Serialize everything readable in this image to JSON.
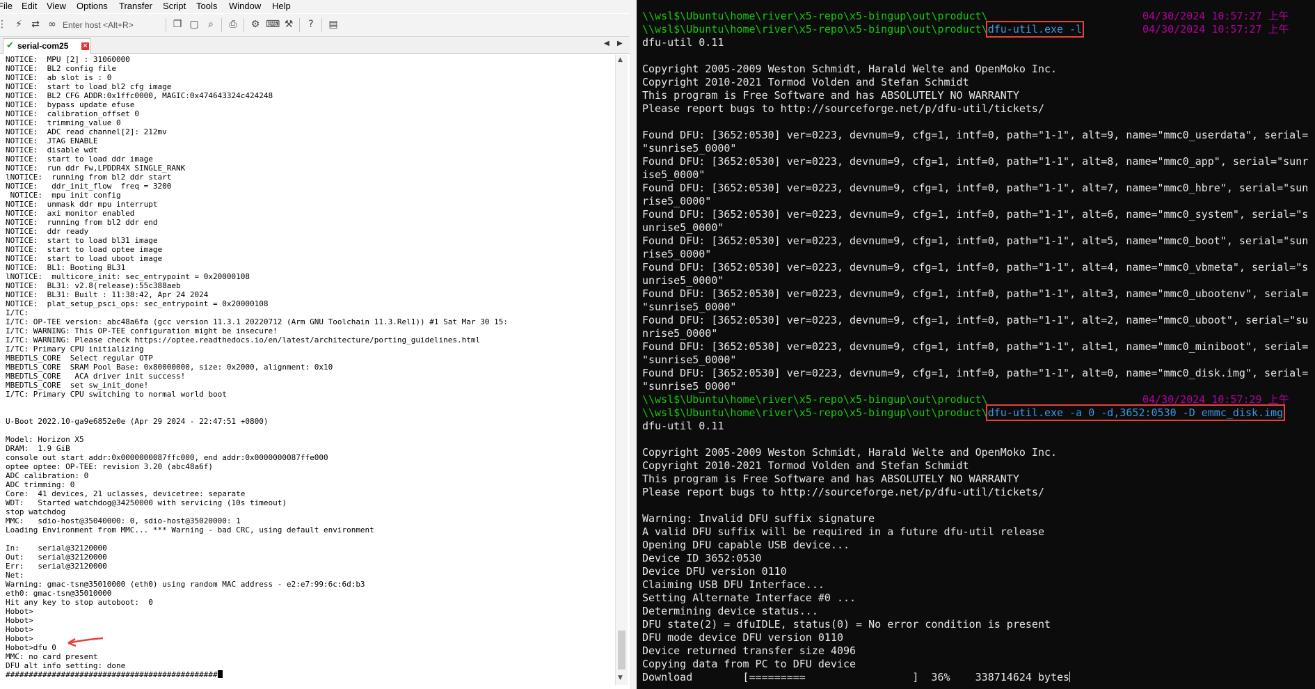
{
  "menu": [
    "File",
    "Edit",
    "View",
    "Options",
    "Transfer",
    "Script",
    "Tools",
    "Window",
    "Help"
  ],
  "toolbar": {
    "host_placeholder": "Enter host <Alt+R>",
    "icons": [
      "lightning-icon",
      "reconnect-icon",
      "link-icon",
      "copy-icon",
      "paste-icon",
      "find-icon",
      "print-icon",
      "settings-icon",
      "keymap-icon",
      "sftp-icon",
      "help-icon",
      "log-icon"
    ]
  },
  "tab": {
    "label": "serial-com25"
  },
  "serial_lines": [
    "NOTICE:  MPU [2] : 31060000",
    "NOTICE:  BL2 config file",
    "NOTICE:  ab slot is : 0",
    "NOTICE:  start to load bl2 cfg image",
    "NOTICE:  BL2 CFG ADDR:0x1ffc0000, MAGIC:0x474643324c424248",
    "NOTICE:  bypass update efuse",
    "NOTICE:  calibration_offset 0",
    "NOTICE:  trimming_value 0",
    "NOTICE:  ADC read channel[2]: 212mv",
    "NOTICE:  JTAG ENABLE",
    "NOTICE:  disable wdt",
    "NOTICE:  start to load ddr image",
    "NOTICE:  run ddr Fw,LPDDR4X SINGLE_RANK",
    "lNOTICE:  running from bl2 ddr start",
    "NOTICE:   ddr_init_flow  freq = 3200",
    " NOTICE:  mpu init config",
    "NOTICE:  unmask ddr mpu interrupt",
    "NOTICE:  axi monitor enabled",
    "NOTICE:  running from bl2 ddr end",
    "NOTICE:  ddr ready",
    "NOTICE:  start to load bl31 image",
    "NOTICE:  start to load optee image",
    "NOTICE:  start to load uboot image",
    "NOTICE:  BL1: Booting BL31",
    "lNOTICE:  multicore_init: sec_entrypoint = 0x20000108",
    "NOTICE:  BL31: v2.8(release):55c388aeb",
    "NOTICE:  BL31: Built : 11:38:42, Apr 24 2024",
    "NOTICE:  plat_setup_psci_ops: sec_entrypoint = 0x20000108",
    "I/TC:",
    "I/TC: OP-TEE version: abc48a6fa (gcc version 11.3.1 20220712 (Arm GNU Toolchain 11.3.Rel1)) #1 Sat Mar 30 15:",
    "I/TC: WARNING: This OP-TEE configuration might be insecure!",
    "I/TC: WARNING: Please check https://optee.readthedocs.io/en/latest/architecture/porting_guidelines.html",
    "I/TC: Primary CPU initializing",
    "MBEDTLS_CORE  Select regular OTP",
    "MBEDTLS_CORE  SRAM Pool Base: 0x80000000, size: 0x2000, alignment: 0x10",
    "MBEDTLS_CORE   ACA driver init success!",
    "MBEDTLS_CORE  set sw_init_done!",
    "I/TC: Primary CPU switching to normal world boot",
    "",
    "",
    "U-Boot 2022.10-ga9e6852e0e (Apr 29 2024 - 22:47:51 +0800)",
    "",
    "Model: Horizon X5",
    "DRAM:  1.9 GiB",
    "console out start addr:0x0000000087ffc000, end addr:0x0000000087ffe000",
    "optee optee: OP-TEE: revision 3.20 (abc48a6f)",
    "ADC calibration: 0",
    "ADC trimming: 0",
    "Core:  41 devices, 21 uclasses, devicetree: separate",
    "WDT:   Started watchdog@34250000 with servicing (10s timeout)",
    "stop watchdog",
    "MMC:   sdio-host@35040000: 0, sdio-host@35020000: 1",
    "Loading Environment from MMC... *** Warning - bad CRC, using default environment",
    "",
    "In:    serial@32120000",
    "Out:   serial@32120000",
    "Err:   serial@32120000",
    "Net:",
    "Warning: gmac-tsn@35010000 (eth0) using random MAC address - e2:e7:99:6c:6d:b3",
    "eth0: gmac-tsn@35010000",
    "Hit any key to stop autoboot:  0",
    "Hobot>",
    "Hobot>",
    "Hobot>",
    "Hobot>",
    "Hobot>dfu 0",
    "MMC: no card present",
    "DFU alt info setting: done",
    "##############################################"
  ],
  "terminal": {
    "prompt": "\\\\wsl$\\Ubuntu\\home\\river\\x5-repo\\x5-bingup\\out\\product\\",
    "timestamps": [
      "04/30/2024 10:57:27 上午",
      "04/30/2024 10:57:27 上午",
      "04/30/2024 10:57:29 上午"
    ],
    "cmd1": "dfu-util.exe -l",
    "cmd2": "dfu-util.exe -a 0 -d,3652:0530 -D emmc_disk.img",
    "block1": [
      "dfu-util 0.11",
      "",
      "Copyright 2005-2009 Weston Schmidt, Harald Welte and OpenMoko Inc.",
      "Copyright 2010-2021 Tormod Volden and Stefan Schmidt",
      "This program is Free Software and has ABSOLUTELY NO WARRANTY",
      "Please report bugs to http://sourceforge.net/p/dfu-util/tickets/",
      "",
      "Found DFU: [3652:0530] ver=0223, devnum=9, cfg=1, intf=0, path=\"1-1\", alt=9, name=\"mmc0_userdata\", serial=",
      "\"sunrise5_0000\"",
      "Found DFU: [3652:0530] ver=0223, devnum=9, cfg=1, intf=0, path=\"1-1\", alt=8, name=\"mmc0_app\", serial=\"sunr",
      "ise5_0000\"",
      "Found DFU: [3652:0530] ver=0223, devnum=9, cfg=1, intf=0, path=\"1-1\", alt=7, name=\"mmc0_hbre\", serial=\"sun",
      "rise5_0000\"",
      "Found DFU: [3652:0530] ver=0223, devnum=9, cfg=1, intf=0, path=\"1-1\", alt=6, name=\"mmc0_system\", serial=\"s",
      "unrise5_0000\"",
      "Found DFU: [3652:0530] ver=0223, devnum=9, cfg=1, intf=0, path=\"1-1\", alt=5, name=\"mmc0_boot\", serial=\"sun",
      "rise5_0000\"",
      "Found DFU: [3652:0530] ver=0223, devnum=9, cfg=1, intf=0, path=\"1-1\", alt=4, name=\"mmc0_vbmeta\", serial=\"s",
      "unrise5_0000\"",
      "Found DFU: [3652:0530] ver=0223, devnum=9, cfg=1, intf=0, path=\"1-1\", alt=3, name=\"mmc0_ubootenv\", serial=",
      "\"sunrise5_0000\"",
      "Found DFU: [3652:0530] ver=0223, devnum=9, cfg=1, intf=0, path=\"1-1\", alt=2, name=\"mmc0_uboot\", serial=\"su",
      "nrise5_0000\"",
      "Found DFU: [3652:0530] ver=0223, devnum=9, cfg=1, intf=0, path=\"1-1\", alt=1, name=\"mmc0_miniboot\", serial=",
      "\"sunrise5_0000\"",
      "Found DFU: [3652:0530] ver=0223, devnum=9, cfg=1, intf=0, path=\"1-1\", alt=0, name=\"mmc0_disk.img\", serial=",
      "\"sunrise5_0000\""
    ],
    "block2": [
      "dfu-util 0.11",
      "",
      "Copyright 2005-2009 Weston Schmidt, Harald Welte and OpenMoko Inc.",
      "Copyright 2010-2021 Tormod Volden and Stefan Schmidt",
      "This program is Free Software and has ABSOLUTELY NO WARRANTY",
      "Please report bugs to http://sourceforge.net/p/dfu-util/tickets/",
      "",
      "Warning: Invalid DFU suffix signature",
      "A valid DFU suffix will be required in a future dfu-util release",
      "Opening DFU capable USB device...",
      "Device ID 3652:0530",
      "Device DFU version 0110",
      "Claiming USB DFU Interface...",
      "Setting Alternate Interface #0 ...",
      "Determining device status...",
      "DFU state(2) = dfuIDLE, status(0) = No error condition is present",
      "DFU mode device DFU version 0110",
      "Device returned transfer size 4096",
      "Copying data from PC to DFU device"
    ],
    "download_line": "Download        [=========                 ]  36%    338714624 bytes"
  },
  "colors": {
    "prompt": "#16c60c",
    "timestamp": "#b4009e",
    "command": "#3a96dd",
    "highlight_box": "#e5413e",
    "annotation_arrow": "#e5413e"
  }
}
